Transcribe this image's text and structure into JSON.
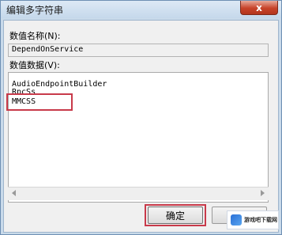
{
  "window": {
    "title": "编辑多字符串",
    "close_label": "x"
  },
  "value_name": {
    "label": "数值名称(N):",
    "value": "DependOnService"
  },
  "value_data": {
    "label": "数值数据(V):",
    "lines": [
      "AudioEndpointBuilder",
      "RpcSs",
      "MMCSS"
    ],
    "highlighted_line": "MMCSS"
  },
  "buttons": {
    "ok_label": "确定",
    "cancel_label": ""
  },
  "watermark": {
    "text": "游戏吧下载网"
  },
  "colors": {
    "highlight": "#c83a4a",
    "close_button": "#c7432a"
  }
}
